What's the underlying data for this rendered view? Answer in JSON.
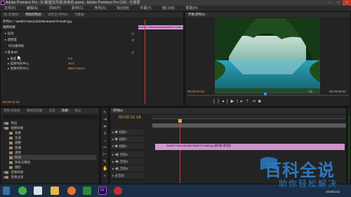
{
  "window": {
    "title": "Adobe Premiere Pro - E:\\新建文件夹\\未命名.prproj - Adobe Premiere Pro CS6 - 已录屏"
  },
  "menu": [
    "文件(F)",
    "编辑(E)",
    "项目(P)",
    "素材(C)",
    "序列(S)",
    "标记(M)",
    "字幕(T)",
    "窗口(W)",
    "帮助(H)"
  ],
  "effect_controls": {
    "tabs": [
      "源:(无素材)",
      "特效控制台",
      "调音台:序列01",
      "元数据"
    ],
    "clip_name": "序列01 * 5a98f27265cb3fd4f8e96a0b7b75a8f.jpg",
    "clip_on_track": "5a98f27265cb3fd4f8e96a0b7b75a8f.jpg",
    "video_effects": "视频效果",
    "motion": "运动",
    "opacity": "透明度",
    "time_remap": "时间重映射",
    "transform": "基本3D",
    "params": [
      {
        "label": "角度",
        "value": "0.0"
      },
      {
        "label": "选择时的中心",
        "value": "20.0"
      },
      {
        "label": "变换时的中心",
        "value": "960.0   540.0"
      }
    ],
    "timecode": "00:00:01:16"
  },
  "program_monitor": {
    "tab": "节目:序列01",
    "timecode": "00:00:01:16",
    "fit": "适合",
    "ratio": "1/2",
    "duration": "00:00:05:00"
  },
  "project_panel": {
    "tabs": [
      "项目:未命名",
      "媒体浏览器",
      "信息",
      "效果",
      "标记",
      "历史"
    ],
    "items": [
      "预设",
      "音频效果",
      "音频过渡",
      "视频效果",
      "变换",
      "生成",
      "调整",
      "扭曲",
      "透视",
      "时间",
      "杂色与颗粒",
      "键控"
    ]
  },
  "timeline": {
    "tab": "序列01",
    "timecode": "00:00:01:16",
    "tracks": [
      {
        "name": "视频3"
      },
      {
        "name": "视频2"
      },
      {
        "name": "视频1"
      },
      {
        "name": "音频1"
      },
      {
        "name": "音频2"
      },
      {
        "name": "音频3"
      },
      {
        "name": "主音轨"
      }
    ],
    "clip_label": "5a98f27265cb3fd4f8e96a0b7b75a8f.jpg 透明度:透明度"
  },
  "taskbar": {
    "time": "",
    "date": "2019/1/12"
  },
  "watermark": {
    "title": "百科全说",
    "subtitle": "助你轻松解决"
  }
}
